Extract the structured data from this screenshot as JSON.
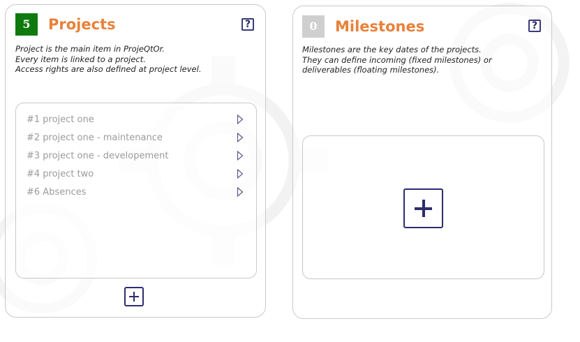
{
  "projects": {
    "count": "5",
    "badge_color": "#0e7a0e",
    "title": "Projects",
    "help_label": "?",
    "description": [
      "Project is the main item in ProjeQtOr.",
      "Every item is linked to a project.",
      "Access rights are also defined at project level."
    ],
    "items": [
      {
        "label": "#1 project one"
      },
      {
        "label": "#2 project one - maintenance"
      },
      {
        "label": "#3 project one - developement"
      },
      {
        "label": "#4 project two"
      },
      {
        "label": "#6 Absences"
      }
    ],
    "item_icon": "chevron-right-icon",
    "add_icon": "plus-icon"
  },
  "milestones": {
    "count": "0",
    "badge_color": "#cfcfcf",
    "title": "Milestones",
    "help_label": "?",
    "description": [
      "Milestones are the key dates of the projects.",
      "They can define incoming (fixed milestones) or",
      "deliverables (floating milestones)."
    ],
    "add_icon": "plus-icon"
  },
  "colors": {
    "title_orange": "#e8813a",
    "accent_navy": "#2d2d6e"
  }
}
